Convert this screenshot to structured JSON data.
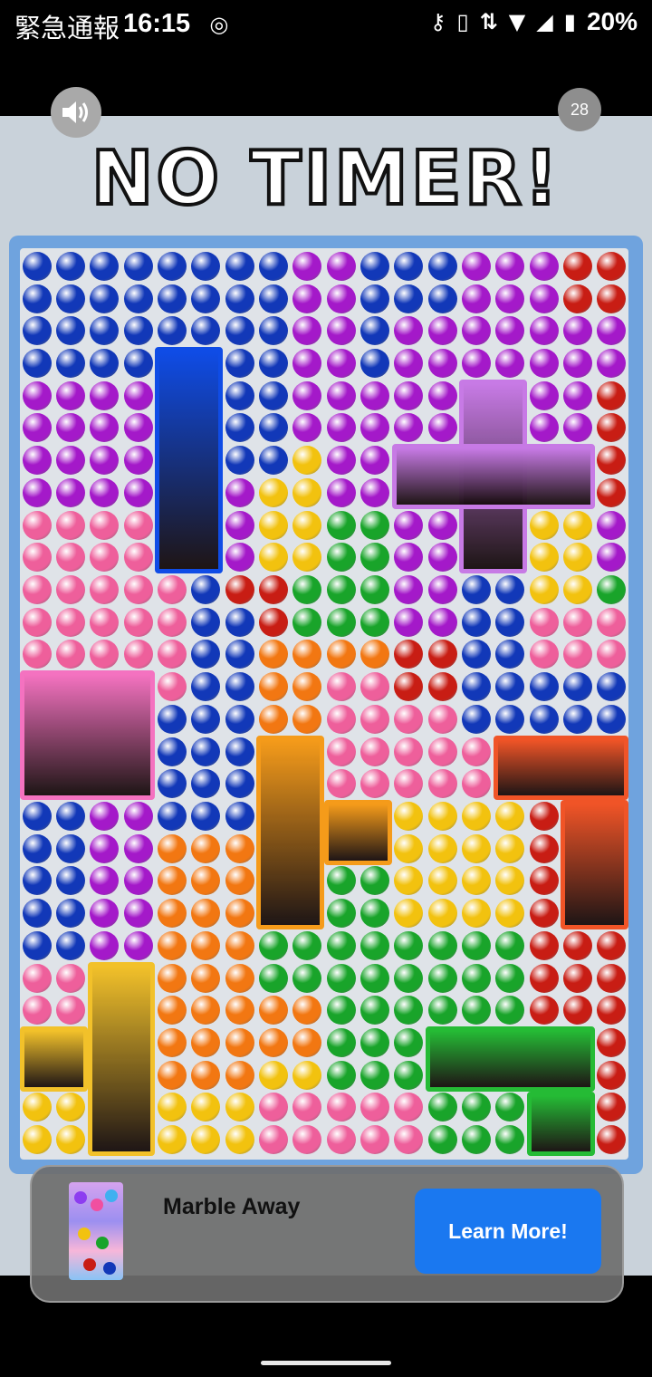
{
  "status_bar": {
    "carrier_text": "緊急通報",
    "time": "16:15",
    "battery": "20%",
    "icons": [
      "vpn-key-icon",
      "vibrate-icon",
      "data-arrows-icon",
      "wifi-icon",
      "signal-icon",
      "battery-icon"
    ]
  },
  "ad": {
    "counter": "28",
    "headline": "NO TIMER!",
    "app_name": "Marble Away",
    "cta_label": "Learn More!"
  },
  "board": {
    "marble_colors": {
      "B": "#1238b8",
      "P": "#a419c9",
      "R": "#c81d14",
      "K": "#ee5f9b",
      "Y": "#f2c20f",
      "G": "#19a42a",
      "O": "#f27712"
    },
    "pen_colors": {
      "blue": "#0f4ce6",
      "purple": "#c77ae5",
      "pink": "#f472c0",
      "orange": "#f59b1a",
      "red": "#f05427",
      "yellow": "#f2c12a",
      "green": "#25bb35"
    }
  }
}
